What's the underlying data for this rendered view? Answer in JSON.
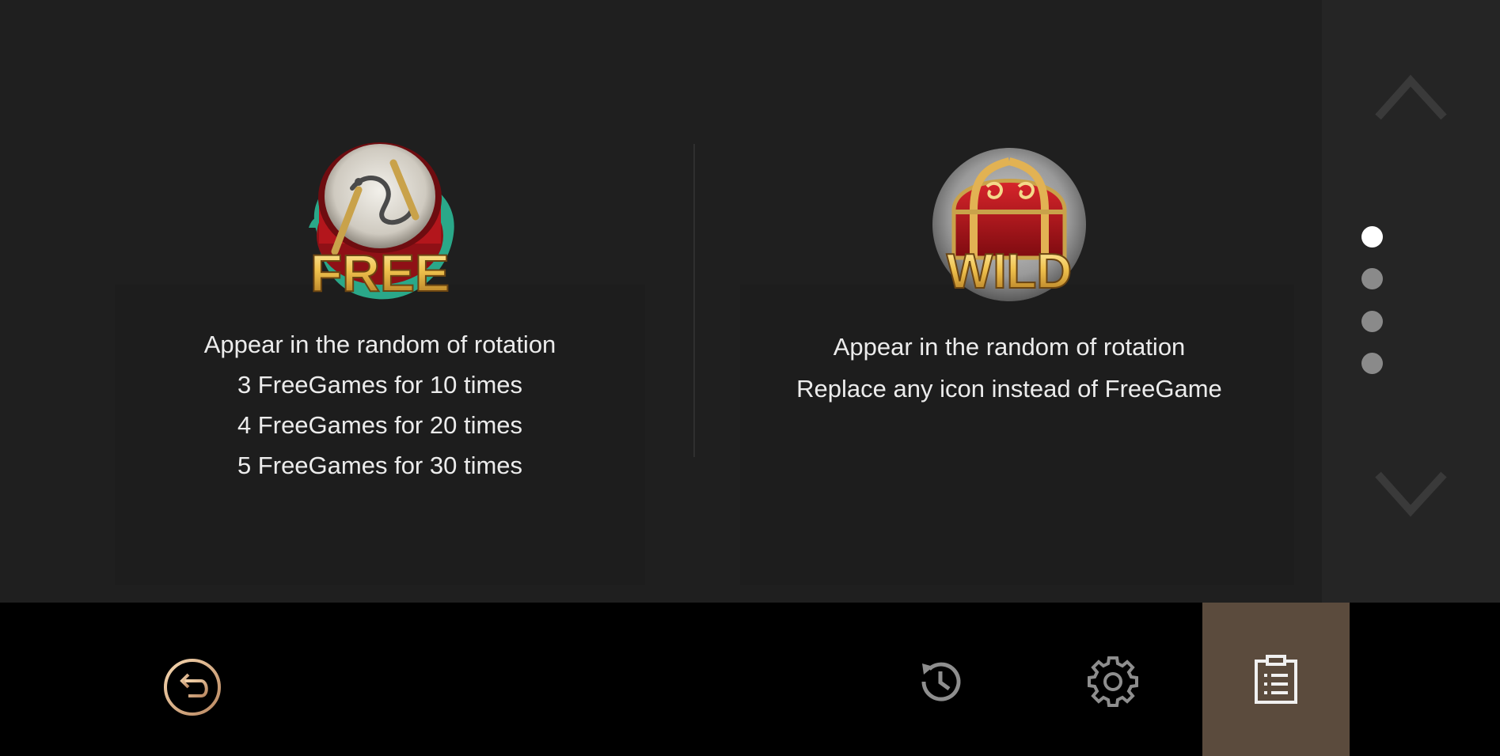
{
  "symbols": [
    {
      "id": "free",
      "badge_text": "FREE",
      "icon": "drum-icon",
      "lines": [
        "Appear in the random of rotation",
        "3 FreeGames for 10 times",
        "4 FreeGames for 20 times",
        "5 FreeGames for 30 times"
      ]
    },
    {
      "id": "wild",
      "badge_text": "WILD",
      "icon": "treasure-chest-icon",
      "lines": [
        "Appear in the random of rotation",
        "Replace any icon instead of FreeGame"
      ]
    }
  ],
  "pager": {
    "page_count": 4,
    "active_page": 1,
    "up_icon": "chevron-up-icon",
    "down_icon": "chevron-down-icon"
  },
  "toolbar": {
    "back_icon": "back-arrow-icon",
    "history_icon": "history-icon",
    "settings_icon": "gear-icon",
    "rules_icon": "clipboard-list-icon",
    "active_tab": "rules"
  },
  "colors": {
    "background": "#1f1f1f",
    "toolbar": "#000000",
    "active_tab": "#5b4b3d",
    "text": "#ececec",
    "gold": "#e2b253",
    "free_teal": "#2aa889",
    "wild_red": "#b3161c"
  }
}
